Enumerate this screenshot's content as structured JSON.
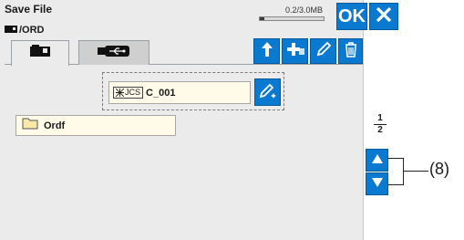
{
  "header": {
    "title": "Save File",
    "path": "/ORD",
    "memory": "0.2/3.0MB",
    "memory_used_fraction": 0.067
  },
  "buttons": {
    "ok_label": "OK"
  },
  "tabs": [
    {
      "icon": "machine-memory-icon",
      "active": true
    },
    {
      "icon": "usb-icon",
      "active": false
    }
  ],
  "toolbar": [
    "up-folder-icon",
    "new-folder-icon",
    "pencil-icon",
    "delete-icon"
  ],
  "file_name": {
    "prefix": "JCS",
    "value": "C_001"
  },
  "folders": [
    {
      "name": "Ordf"
    }
  ],
  "pagination": {
    "current": "1",
    "total": "2"
  },
  "callout": {
    "label": "(8)"
  },
  "colors": {
    "accent": "#0a7ad1",
    "field_bg": "#fffbe8",
    "panel_bg": "#ebebeb"
  }
}
